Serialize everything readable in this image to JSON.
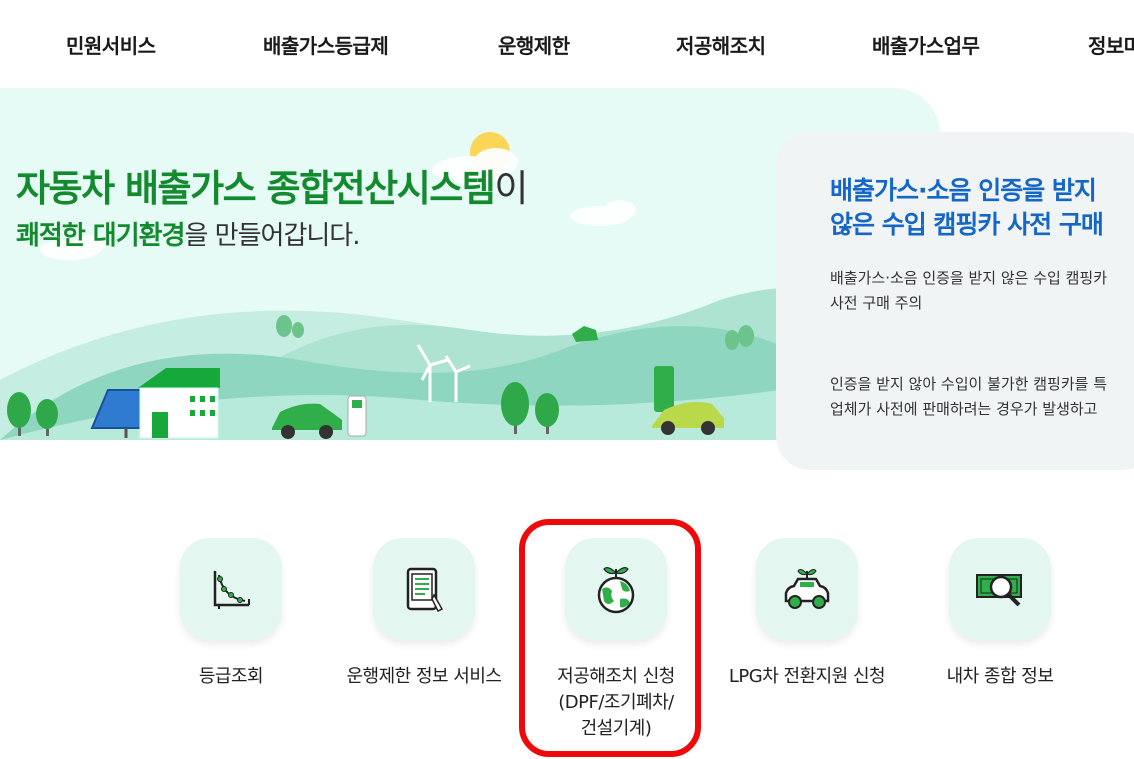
{
  "nav": {
    "items": [
      "민원서비스",
      "배출가스등급제",
      "운행제한",
      "저공해조치",
      "배출가스업무",
      "정보마"
    ]
  },
  "hero": {
    "title_part1": "자동차 ",
    "title_part2": "배출가스 종합전산시스템",
    "title_part3": "이",
    "sub_part1": "쾌적한 대기환경",
    "sub_part2": "을 만들어갑니다."
  },
  "notice": {
    "title_line1": "배출가스·소음 인증을 받지",
    "title_line2": "않은 수입 캠핑카 사전 구매",
    "summary_line1": "배출가스·소음 인증을 받지 않은 수입 캠핑카",
    "summary_line2": "사전 구매 주의",
    "body_line1": "인증을 받지 않아 수입이 불가한 캠핑카를 특",
    "body_line2": "업체가 사전에 판매하려는 경우가 발생하고"
  },
  "quick_menu": [
    {
      "icon": "graph-icon",
      "label": "등급조회"
    },
    {
      "icon": "tablet-icon",
      "label": "운행제한 정보 서비스"
    },
    {
      "icon": "earth-sprout-icon",
      "label_line1": "저공해조치 신청",
      "label_line2": "(DPF/조기폐차/",
      "label_line3": "건설기계)"
    },
    {
      "icon": "eco-car-icon",
      "label": "LPG차 전환지원 신청"
    },
    {
      "icon": "money-search-icon",
      "label": "내차 종합 정보"
    }
  ],
  "colors": {
    "brand_green": "#148a2e",
    "notice_blue": "#1466c8",
    "hero_bg": "#e6fbf6",
    "highlight_red": "#ee0a0a"
  }
}
